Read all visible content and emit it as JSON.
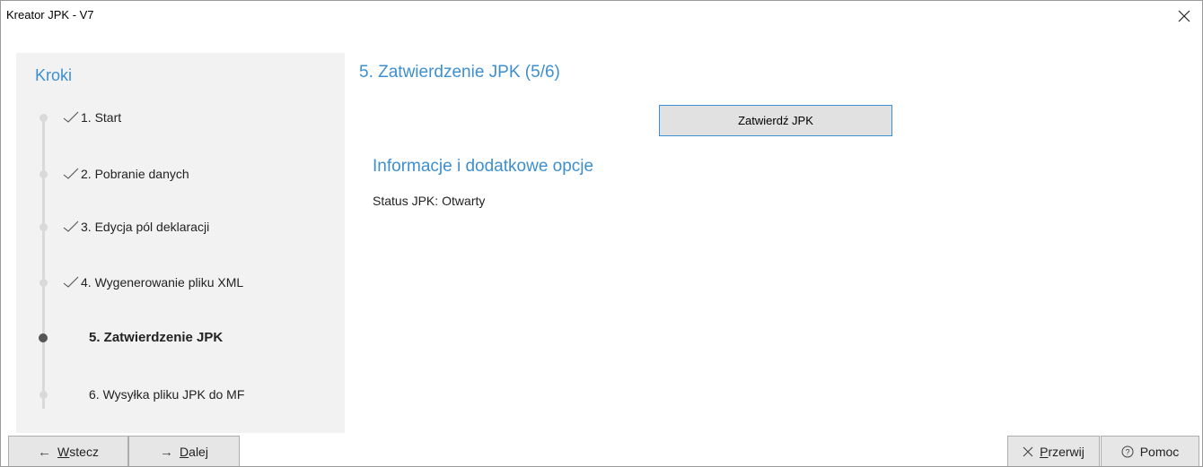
{
  "window": {
    "title": "Kreator JPK - V7"
  },
  "sidebar": {
    "heading": "Kroki",
    "steps": [
      {
        "label": "1. Start",
        "status": "done"
      },
      {
        "label": "2. Pobranie danych",
        "status": "done"
      },
      {
        "label": "3. Edycja pól deklaracji",
        "status": "done"
      },
      {
        "label": "4. Wygenerowanie pliku XML",
        "status": "done"
      },
      {
        "label": "5. Zatwierdzenie JPK",
        "status": "current"
      },
      {
        "label": "6. Wysyłka pliku JPK do MF",
        "status": "pending"
      }
    ]
  },
  "main": {
    "title": "5. Zatwierdzenie JPK (5/6)",
    "approve_button": "Zatwierdź JPK",
    "info_title": "Informacje i dodatkowe opcje",
    "status_label": "Status JPK:",
    "status_value": "Otwarty"
  },
  "footer": {
    "back": {
      "icon": "arrow-left-icon",
      "underline": "W",
      "rest": "stecz"
    },
    "next": {
      "icon": "arrow-right-icon",
      "underline": "D",
      "rest": "alej"
    },
    "cancel": {
      "icon": "close-icon",
      "underline": "P",
      "rest": "rzerwij"
    },
    "help": {
      "icon": "help-circle-icon",
      "label": "Pomoc"
    }
  },
  "colors": {
    "accent": "#3d8fcf",
    "sidebar_bg": "#f2f2f2",
    "button_bg": "#e6e6e6"
  }
}
